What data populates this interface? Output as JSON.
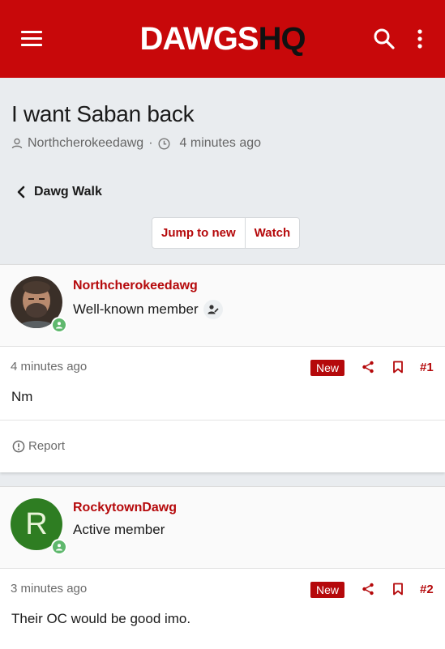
{
  "header": {
    "logo_part1": "DAWGS",
    "logo_part2": "HQ",
    "menu_icon": "hamburger-menu-icon",
    "search_icon": "search-icon",
    "more_icon": "kebab-menu-icon",
    "brand_color": "#c8080a"
  },
  "thread": {
    "title": "I want Saban back",
    "author": "Northcherokeedawg",
    "separator": "·",
    "time": "4 minutes ago",
    "back_label": "Dawg Walk",
    "jump_label": "Jump to new",
    "watch_label": "Watch"
  },
  "posts": [
    {
      "username": "Northcherokeedawg",
      "user_title": "Well-known member",
      "time": "4 minutes ago",
      "new_label": "New",
      "number": "#1",
      "body": "Nm",
      "report_label": "Report"
    },
    {
      "username": "RockytownDawg",
      "avatar_letter": "R",
      "user_title": "Active member",
      "time": "3 minutes ago",
      "new_label": "New",
      "number": "#2",
      "body": "Their OC would be good imo."
    }
  ],
  "colors": {
    "accent": "#b5090b",
    "online": "#5fb86d",
    "avatar_r_bg": "#2e7d22"
  }
}
